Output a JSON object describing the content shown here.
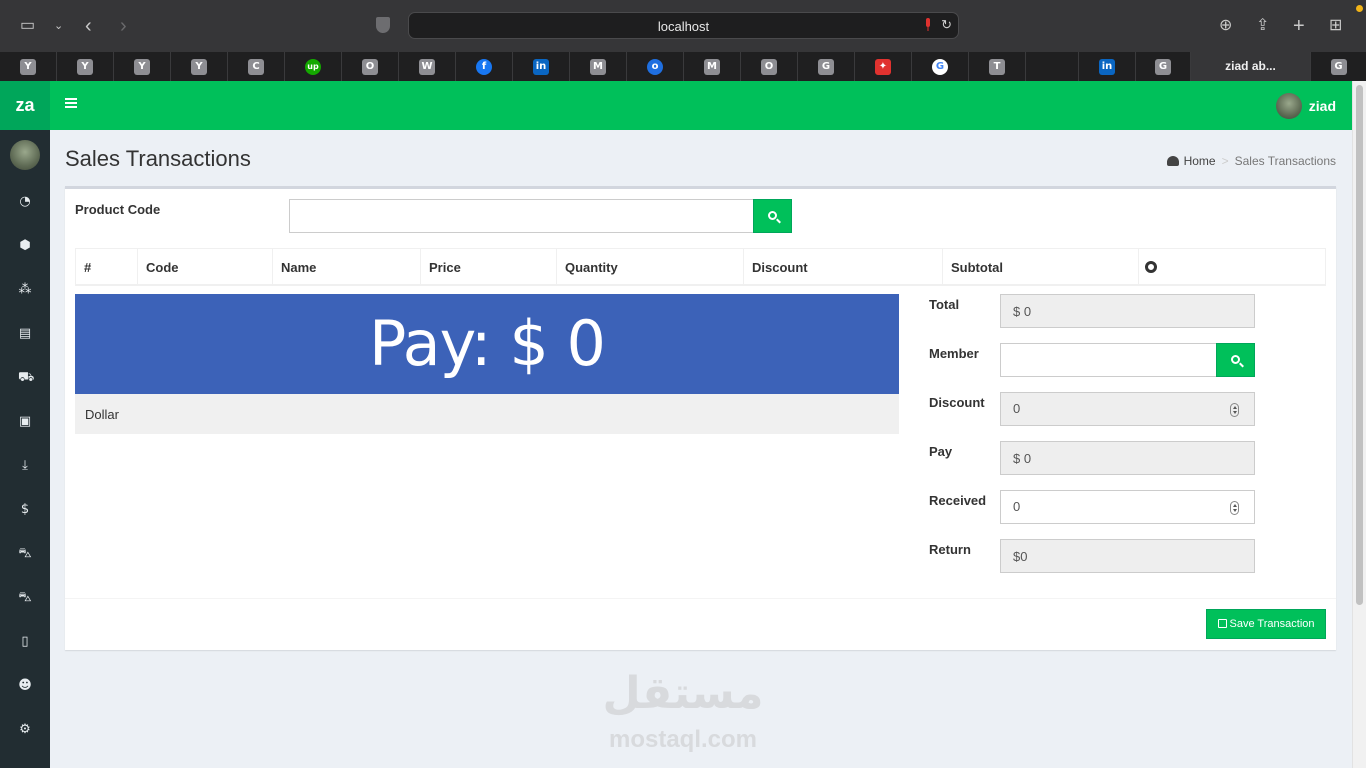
{
  "browser": {
    "url": "localhost",
    "active_tab_title": "ziad ab...",
    "tab_favicons": [
      "Y",
      "Y",
      "Y",
      "Y",
      "C",
      "up",
      "O",
      "W",
      "f",
      "in",
      "M",
      "o",
      "M",
      "O",
      "G",
      "✦",
      "G",
      "T",
      "",
      "in",
      "G"
    ],
    "last_tab_favicon": "G"
  },
  "app": {
    "logo": "za",
    "user_name": "ziad",
    "accent_color": "#00c05a",
    "sidebar_color": "#222d32",
    "sidebar_icons": [
      "dashboard-icon",
      "cube-icon",
      "cubes-icon",
      "id-card-icon",
      "truck-icon",
      "money-icon",
      "download-icon",
      "dollar-icon",
      "cart-icon",
      "cart-icon",
      "pdf-icon",
      "users-icon",
      "cogs-icon"
    ]
  },
  "page": {
    "title": "Sales Transactions",
    "breadcrumb": {
      "home": "Home",
      "current": "Sales Transactions"
    }
  },
  "form": {
    "product_code_label": "Product Code",
    "product_code_value": ""
  },
  "table": {
    "headers": [
      "#",
      "Code",
      "Name",
      "Price",
      "Quantity",
      "Discount",
      "Subtotal"
    ]
  },
  "pay": {
    "banner": "Pay: $ 0",
    "banner_color": "#3c62b8",
    "words": "Dollar"
  },
  "summary": {
    "total_label": "Total",
    "total_value": "$ 0",
    "member_label": "Member",
    "member_value": "",
    "discount_label": "Discount",
    "discount_value": "0",
    "pay_label": "Pay",
    "pay_value": "$ 0",
    "received_label": "Received",
    "received_value": "0",
    "return_label": "Return",
    "return_value": "$0"
  },
  "actions": {
    "save_label": "Save Transaction"
  },
  "watermark": {
    "arabic": "مستقل",
    "latin": "mostaql.com"
  }
}
